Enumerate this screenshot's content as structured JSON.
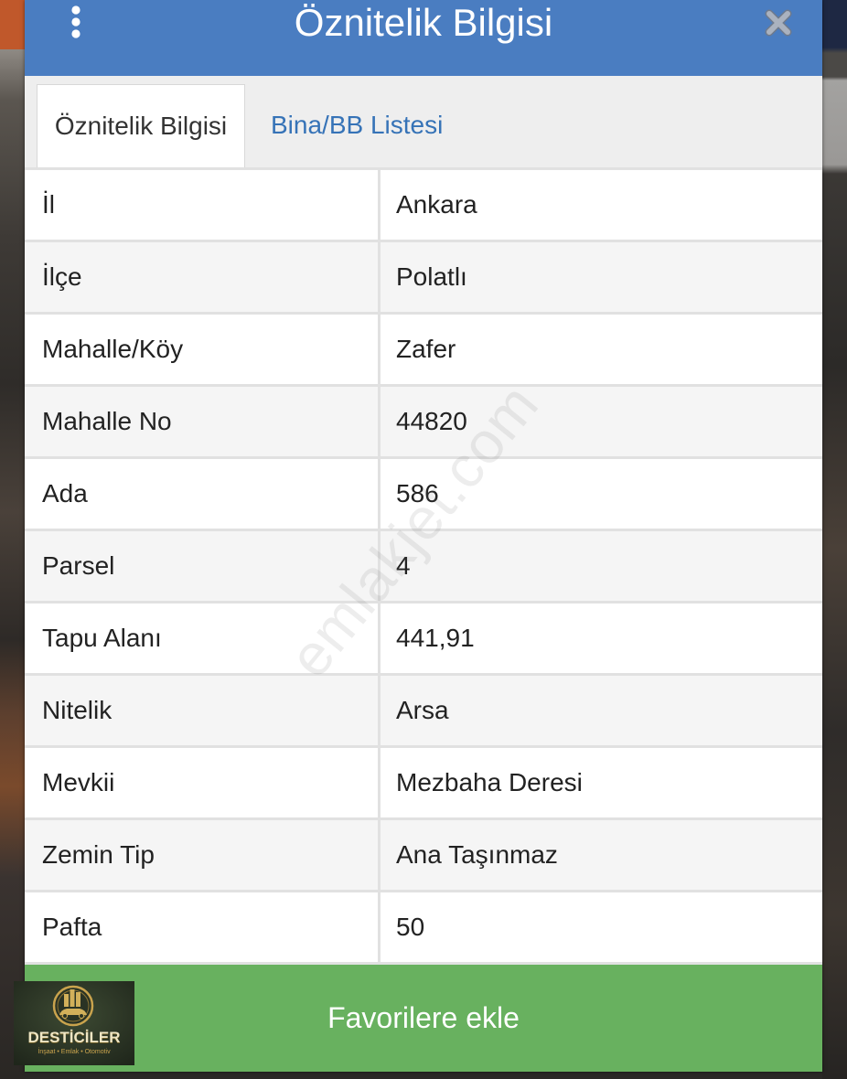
{
  "header": {
    "title": "Öznitelik Bilgisi",
    "menu_icon": "kebab-menu-icon",
    "close_icon": "close-icon"
  },
  "tabs": [
    {
      "label": "Öznitelik Bilgisi",
      "active": true
    },
    {
      "label": "Bina/BB Listesi",
      "active": false
    }
  ],
  "attributes": [
    {
      "label": "İl",
      "value": "Ankara"
    },
    {
      "label": "İlçe",
      "value": "Polatlı"
    },
    {
      "label": "Mahalle/Köy",
      "value": "Zafer"
    },
    {
      "label": "Mahalle No",
      "value": "44820"
    },
    {
      "label": "Ada",
      "value": "586"
    },
    {
      "label": "Parsel",
      "value": "4"
    },
    {
      "label": "Tapu Alanı",
      "value": "441,91"
    },
    {
      "label": "Nitelik",
      "value": "Arsa"
    },
    {
      "label": "Mevkii",
      "value": "Mezbaha Deresi"
    },
    {
      "label": "Zemin Tip",
      "value": "Ana Taşınmaz"
    },
    {
      "label": "Pafta",
      "value": "50"
    }
  ],
  "footer": {
    "button_label": "Favorilere ekle"
  },
  "watermark": {
    "text": "emlakjet.com"
  },
  "logo": {
    "name": "DESTİCİLER",
    "tagline": "İnşaat • Emlak • Otomotiv",
    "icon": "building-car-emblem-icon"
  },
  "colors": {
    "header": "#4a7dc1",
    "tab_link": "#3673b7",
    "tab_bar": "#eeeeee",
    "button": "#68b15f",
    "row_alt": "#f5f5f5",
    "border": "#e1e1e1"
  }
}
